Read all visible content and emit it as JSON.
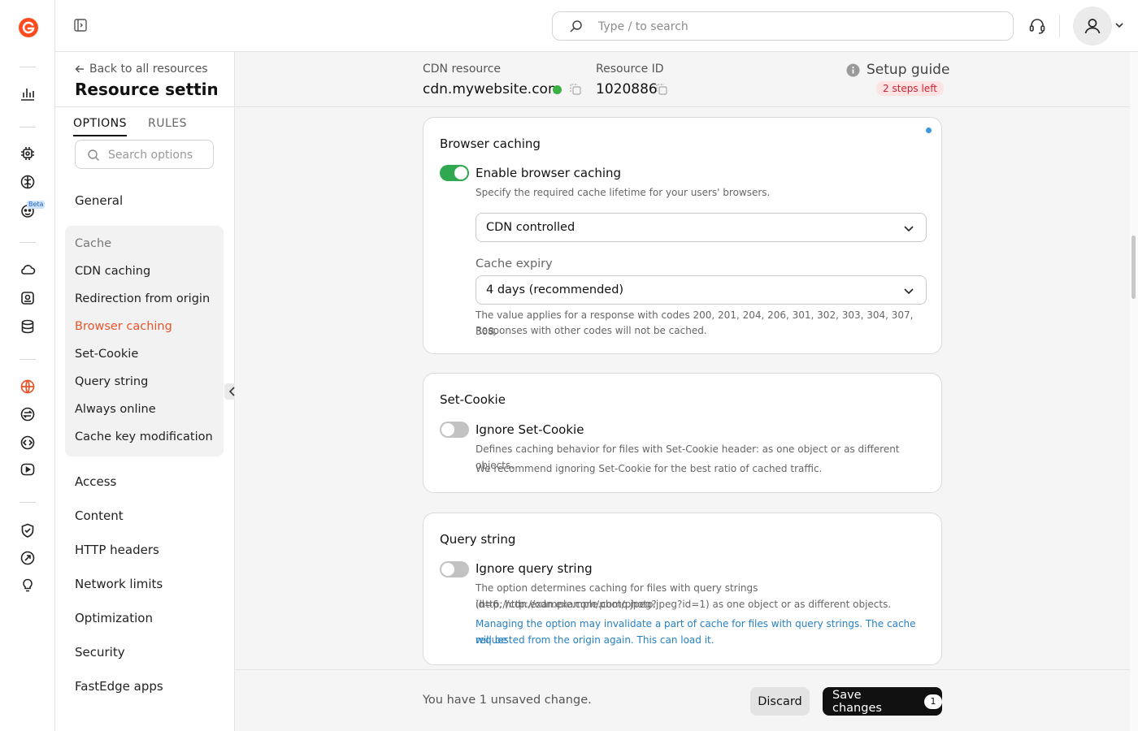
{
  "topbar": {
    "search_placeholder": "Type / to search"
  },
  "panel": {
    "back_label": "Back to all resources",
    "title": "Resource settin...",
    "tabs": [
      {
        "label": "OPTIONS"
      },
      {
        "label": "RULES"
      }
    ],
    "search_placeholder": "Search options",
    "nav_general": "General",
    "cache_group": {
      "header": "Cache",
      "items": [
        "CDN caching",
        "Redirection from origin",
        "Browser caching",
        "Set-Cookie",
        "Query string",
        "Always online",
        "Cache key modification"
      ]
    },
    "nav_items": [
      "Access",
      "Content",
      "HTTP headers",
      "Network limits",
      "Optimization",
      "Security",
      "FastEdge apps"
    ]
  },
  "rail": {
    "beta_label": "Beta"
  },
  "resource": {
    "cdn_label": "CDN resource",
    "cdn_value": "cdn.mywebsite.com",
    "id_label": "Resource ID",
    "id_value": "1020886",
    "setup_label": "Setup guide",
    "steps_left": "2 steps left"
  },
  "cards": {
    "browser": {
      "title": "Browser caching",
      "toggle_label": "Enable browser caching",
      "toggle_on": true,
      "desc": "Specify the required cache lifetime for your users' browsers.",
      "mode_value": "CDN controlled",
      "expiry_label": "Cache expiry",
      "expiry_value": "4 days (recommended)",
      "note1": "The value applies for a response with codes 200, 201, 204, 206, 301, 302, 303, 304, 307, 308.",
      "note2": "Responses with other codes will not be cached."
    },
    "setcookie": {
      "title": "Set-Cookie",
      "toggle_label": "Ignore Set-Cookie",
      "toggle_on": false,
      "desc1": "Defines caching behavior for files with Set-Cookie header: as one object or as different objects.",
      "desc2": "We recommend ignoring Set-Cookie for the best ratio of cached traffic."
    },
    "query": {
      "title": "Query string",
      "toggle_label": "Ignore query string",
      "toggle_on": false,
      "desc1": "The option determines caching for files with query strings (http://cdn.example.com/photo.jpeg?",
      "desc2": "id=6, http://cdn.example.com/photo.jpeg?id=1) as one object or as different objects.",
      "warn1": "Managing the option may invalidate a part of cache for files with query strings. The cache will be",
      "warn2": "requested from the origin again. This can load it."
    }
  },
  "footer": {
    "unsaved": "You have 1 unsaved change.",
    "discard": "Discard",
    "save": "Save changes",
    "save_count": "1"
  },
  "colors": {
    "accent": "#e8542a",
    "toggle_on": "#2fa84f",
    "link": "#2780c4"
  }
}
